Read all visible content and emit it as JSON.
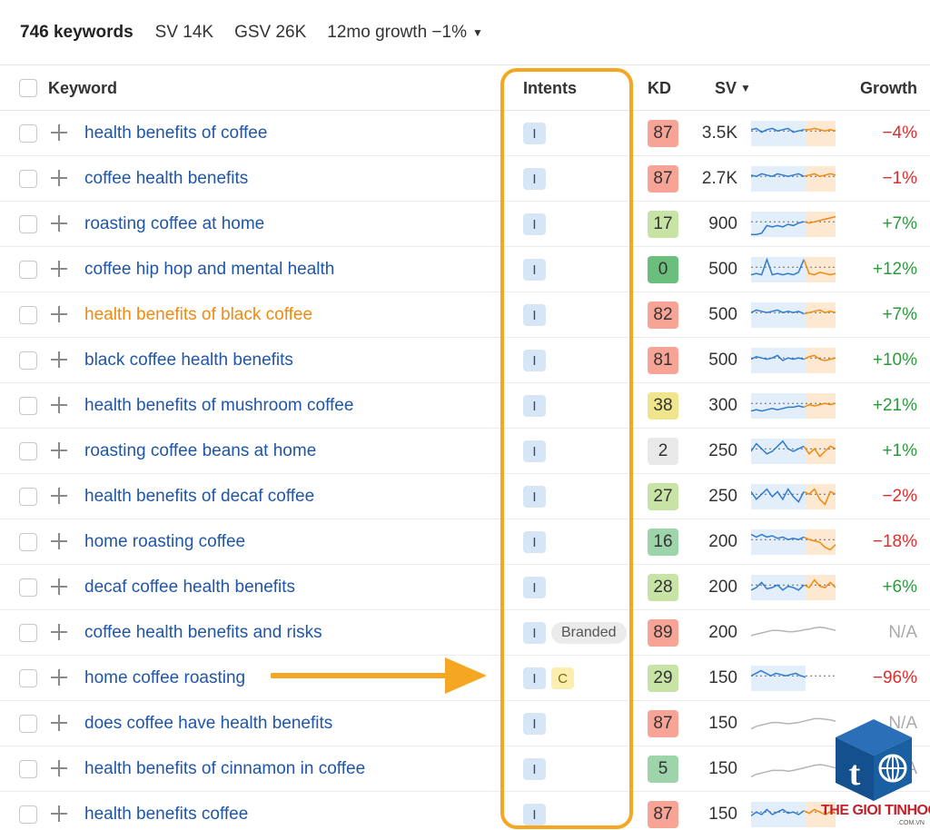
{
  "summary": {
    "keyword_count": "746 keywords",
    "sv": "SV 14K",
    "gsv": "GSV 26K",
    "growth": "12mo growth −1%"
  },
  "columns": {
    "keyword": "Keyword",
    "intents": "Intents",
    "kd": "KD",
    "sv": "SV",
    "growth": "Growth"
  },
  "colors": {
    "highlight": "#f5a623",
    "link": "#1f56a8",
    "link_visited": "#ef8a12",
    "negative": "#dd2e2e",
    "positive": "#2c9a3c",
    "kd_red": "#f7a497",
    "kd_light_green": "#c7e3a6",
    "kd_green": "#9dd4aa",
    "kd_dark_green": "#6bbf7d",
    "kd_yellow": "#eee58c",
    "kd_gray": "#e9e9e9"
  },
  "rows": [
    {
      "keyword": "health benefits of coffee",
      "intents": [
        "I"
      ],
      "kd": "87",
      "sv": "3.5K",
      "growth": "−4%"
    },
    {
      "keyword": "coffee health benefits",
      "intents": [
        "I"
      ],
      "kd": "87",
      "sv": "2.7K",
      "growth": "−1%"
    },
    {
      "keyword": "roasting coffee at home",
      "intents": [
        "I"
      ],
      "kd": "17",
      "sv": "900",
      "growth": "+7%"
    },
    {
      "keyword": "coffee hip hop and mental health",
      "intents": [
        "I"
      ],
      "kd": "0",
      "sv": "500",
      "growth": "+12%"
    },
    {
      "keyword": "health benefits of black coffee",
      "intents": [
        "I"
      ],
      "kd": "82",
      "sv": "500",
      "growth": "+7%"
    },
    {
      "keyword": "black coffee health benefits",
      "intents": [
        "I"
      ],
      "kd": "81",
      "sv": "500",
      "growth": "+10%"
    },
    {
      "keyword": "health benefits of mushroom coffee",
      "intents": [
        "I"
      ],
      "kd": "38",
      "sv": "300",
      "growth": "+21%"
    },
    {
      "keyword": "roasting coffee beans at home",
      "intents": [
        "I"
      ],
      "kd": "2",
      "sv": "250",
      "growth": "+1%"
    },
    {
      "keyword": "health benefits of decaf coffee",
      "intents": [
        "I"
      ],
      "kd": "27",
      "sv": "250",
      "growth": "−2%"
    },
    {
      "keyword": "home roasting coffee",
      "intents": [
        "I"
      ],
      "kd": "16",
      "sv": "200",
      "growth": "−18%"
    },
    {
      "keyword": "decaf coffee health benefits",
      "intents": [
        "I"
      ],
      "kd": "28",
      "sv": "200",
      "growth": "+6%"
    },
    {
      "keyword": "coffee health benefits and risks",
      "intents": [
        "I",
        "Branded"
      ],
      "kd": "89",
      "sv": "200",
      "growth": "N/A"
    },
    {
      "keyword": "home coffee roasting",
      "intents": [
        "I",
        "C"
      ],
      "kd": "29",
      "sv": "150",
      "growth": "−96%"
    },
    {
      "keyword": "does coffee have health benefits",
      "intents": [
        "I"
      ],
      "kd": "87",
      "sv": "150",
      "growth": "N/A"
    },
    {
      "keyword": "health benefits of cinnamon in coffee",
      "intents": [
        "I"
      ],
      "kd": "5",
      "sv": "150",
      "growth": "N/A"
    },
    {
      "keyword": "health benefits coffee",
      "intents": [
        "I"
      ],
      "kd": "87",
      "sv": "150",
      "growth": ""
    }
  ],
  "watermark": {
    "brand": "THE GIOI TINHOC",
    "domain": ".COM.VN"
  }
}
